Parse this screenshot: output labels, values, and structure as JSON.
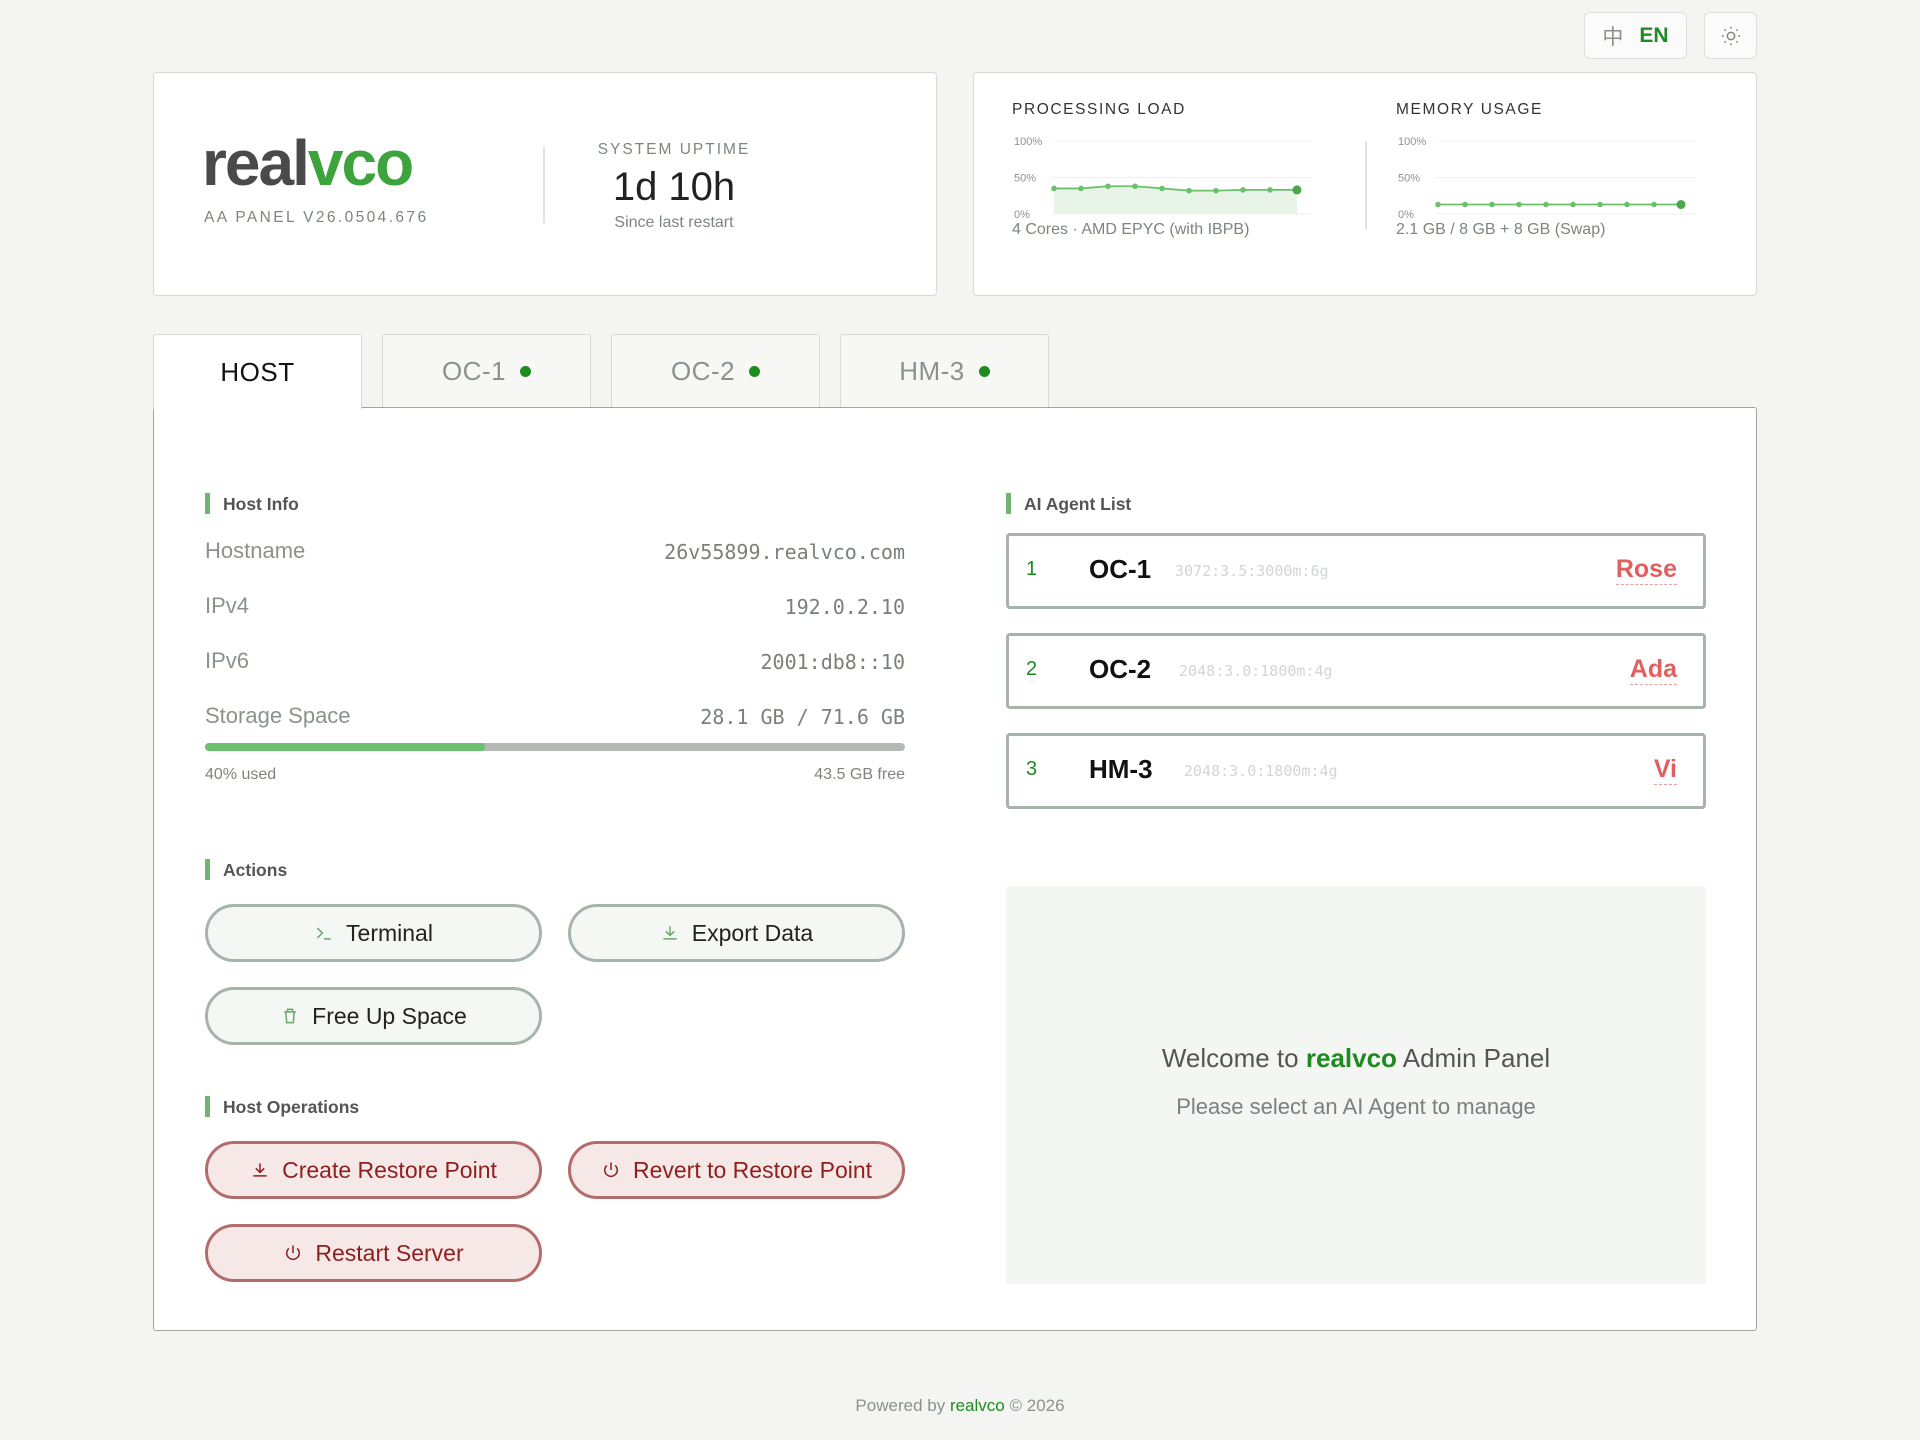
{
  "lang_switch": {
    "zh": "中",
    "en": "EN"
  },
  "brand": {
    "logo_part1": "real",
    "logo_part2": "vco",
    "version": "AA PANEL V26.0504.676",
    "uptime_label": "SYSTEM UPTIME",
    "uptime_value": "1d 10h",
    "uptime_sub": "Since last restart"
  },
  "stats": {
    "cpu": {
      "title": "PROCESSING LOAD",
      "desc": "4 Cores · AMD EPYC (with IBPB)",
      "ticks": [
        "100%",
        "50%",
        "0%"
      ]
    },
    "mem": {
      "title": "MEMORY USAGE",
      "desc": "2.1 GB / 8 GB + 8 GB (Swap)",
      "ticks": [
        "100%",
        "50%",
        "0%"
      ]
    }
  },
  "chart_data": [
    {
      "type": "area",
      "title": "PROCESSING LOAD",
      "ylim": [
        0,
        100
      ],
      "y_ticks": [
        "100%",
        "50%",
        "0%"
      ],
      "values": [
        35,
        35,
        38,
        38,
        35,
        32,
        32,
        33,
        33,
        33
      ]
    },
    {
      "type": "line",
      "title": "MEMORY USAGE",
      "ylim": [
        0,
        100
      ],
      "y_ticks": [
        "100%",
        "50%",
        "0%"
      ],
      "values": [
        13,
        13,
        13,
        13,
        13,
        13,
        13,
        13,
        13,
        13
      ]
    }
  ],
  "tabs": [
    {
      "label": "HOST",
      "active": true
    },
    {
      "label": "OC-1",
      "active": false
    },
    {
      "label": "OC-2",
      "active": false
    },
    {
      "label": "HM-3",
      "active": false
    }
  ],
  "host_info": {
    "title": "Host Info",
    "rows": [
      {
        "key": "Hostname",
        "value": "26v55899.realvco.com"
      },
      {
        "key": "IPv4",
        "value": "192.0.2.10"
      },
      {
        "key": "IPv6",
        "value": "2001:db8::10"
      },
      {
        "key": "Storage Space",
        "value": "28.1 GB / 71.6 GB"
      }
    ],
    "storage_percent": 40,
    "storage_used_text": "40% used",
    "storage_free_text": "43.5 GB free"
  },
  "actions": {
    "title": "Actions",
    "terminal": "Terminal",
    "export": "Export Data",
    "free_space": "Free Up Space"
  },
  "host_ops": {
    "title": "Host Operations",
    "create_restore": "Create Restore Point",
    "revert_restore": "Revert to Restore Point",
    "restart": "Restart Server"
  },
  "agents": {
    "title": "AI Agent List",
    "items": [
      {
        "num": "1",
        "name": "OC-1",
        "spec": "3072:3.5:3000m:6g",
        "owner": "Rose"
      },
      {
        "num": "2",
        "name": "OC-2",
        "spec": "2048:3.0:1800m:4g",
        "owner": "Ada"
      },
      {
        "num": "3",
        "name": "HM-3",
        "spec": "2048:3.0:1800m:4g",
        "owner": "Vi"
      }
    ]
  },
  "welcome": {
    "prefix": "Welcome to",
    "brand": "realvco",
    "suffix": "Admin Panel",
    "subtitle": "Please select an AI Agent to manage"
  },
  "footer": {
    "prefix": "Powered by",
    "brand": "realvco",
    "suffix": "© 2026"
  },
  "colors": {
    "accent": "#1f8a1f",
    "danger": "#8e1f1f",
    "owner": "#e06060"
  }
}
